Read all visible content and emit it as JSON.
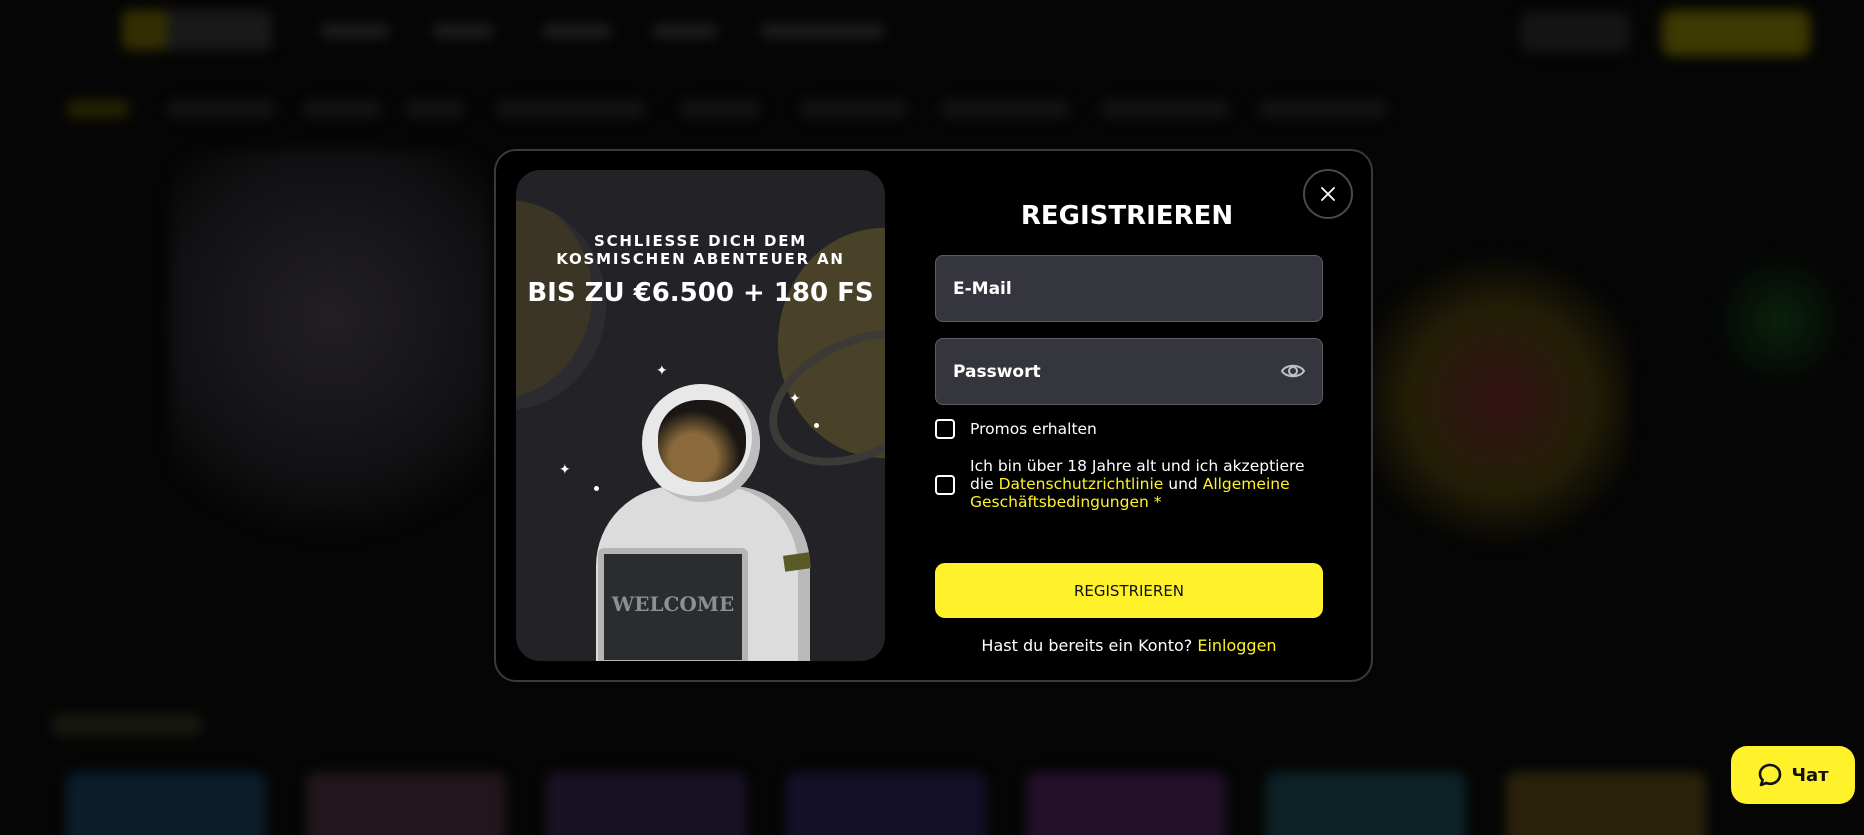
{
  "promo": {
    "subtitle": "SCHLIESSE DICH DEM\nKOSMISCHEN ABENTEUER AN",
    "title": "BIS ZU €6.500 + 180 FS",
    "board_text": "WELCOME"
  },
  "form": {
    "title": "REGISTRIEREN",
    "email_placeholder": "E-Mail",
    "password_placeholder": "Passwort",
    "promos_label": "Promos erhalten",
    "terms_text": "Ich bin über 18 Jahre alt und ich akzeptiere die",
    "privacy_link": "Datenschutzrichtlinie",
    "and_text": "und",
    "terms_link": "Allgemeine Geschäftsbedingungen",
    "required_mark": "*",
    "submit_label": "REGISTRIEREN",
    "have_account_text": "Hast du bereits ein Konto?",
    "login_link": "Einloggen"
  },
  "chat": {
    "label": "Чат"
  },
  "icons": {
    "close": "close-icon",
    "eye": "eye-icon",
    "chat": "chat-bubble-icon"
  },
  "colors": {
    "accent": "#fff12a",
    "modal_bg": "#000000",
    "field_bg": "#35363d",
    "promo_bg": "#222227"
  }
}
